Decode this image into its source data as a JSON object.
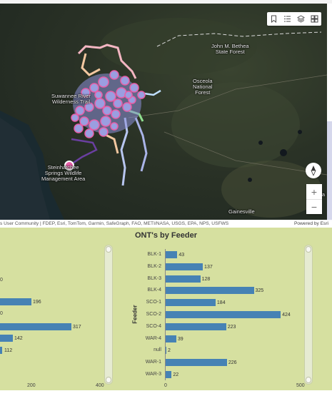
{
  "map": {
    "labels": [
      {
        "key": "mbathea",
        "text": "John M. Bethea\nState Forest"
      },
      {
        "key": "osceola",
        "text": "Osceola\nNational\nForest"
      },
      {
        "key": "suwannee",
        "text": "Suwannee River\nWilderness Trail"
      },
      {
        "key": "steinhatchee",
        "text": "Steinhatchee\nSprings Wildlife\nManagement Area"
      },
      {
        "key": "gainesville",
        "text": "Gainesville"
      },
      {
        "key": "palatka",
        "text": "Palatka\nButler St"
      }
    ],
    "attribution": "s User Community | FDEP, Esri, TomTom, Garmin, SafeGraph, FAO, METI/NASA, USGS, EPA, NPS, USFWS",
    "powered_by": "Powered by Esri",
    "zoom_in": "+",
    "zoom_out": "−",
    "toolbar": [
      "bookmark-icon",
      "layer-list-icon",
      "layers-icon",
      "basemap-gallery-icon"
    ]
  },
  "left_chart": {
    "partial_values": [
      "196",
      "317",
      "142",
      "112"
    ],
    "axis_ticks": [
      "200",
      "400"
    ],
    "partial_ticks": [
      "0",
      "0"
    ]
  },
  "chart_data": {
    "type": "bar",
    "title": "ONT's by Feeder",
    "ylabel": "Feeder",
    "xlabel": "",
    "categories": [
      "BLK-1",
      "BLK-2",
      "BLK-3",
      "BLK-4",
      "SCO-1",
      "SCO-2",
      "SCO-4",
      "WAR-4",
      "null",
      "WAR-1",
      "WAR-3"
    ],
    "values": [
      43,
      137,
      128,
      325,
      184,
      424,
      223,
      39,
      2,
      226,
      22
    ],
    "xlim": [
      0,
      500
    ],
    "xticks": [
      "0",
      "500"
    ],
    "orientation": "horizontal",
    "color": "#4682b4"
  },
  "colors": {
    "panel_bg": "#d6e0a0",
    "bar": "#4682b4"
  }
}
